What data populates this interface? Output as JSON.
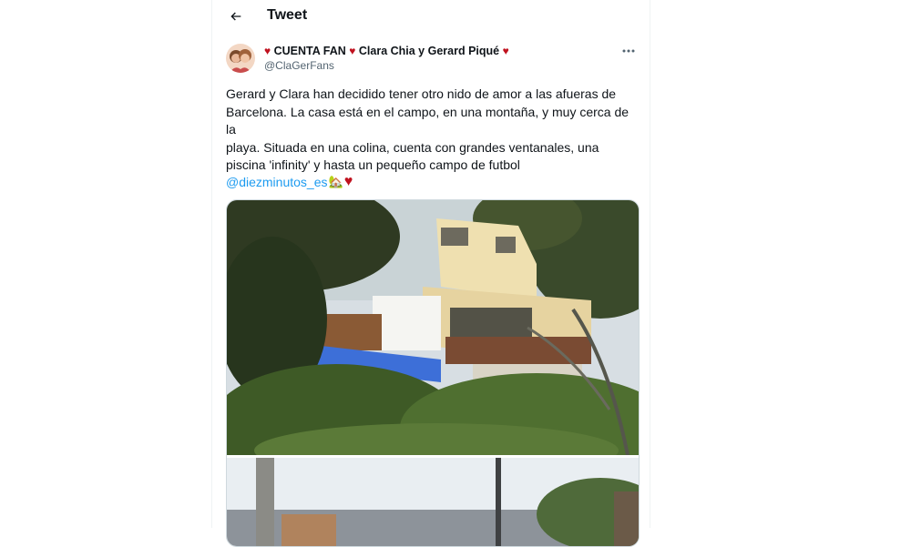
{
  "header": {
    "title": "Tweet",
    "back_icon": "arrow-left-icon"
  },
  "tweet": {
    "display_name_part1": "CUENTA FAN",
    "display_name_part2": "Clara Chia y Gerard Piqué",
    "handle": "@ClaGerFans",
    "text_lines": [
      "Gerard  y Clara han decidido tener otro nido de amor a las afueras de",
      "Barcelona. La casa está en el campo, en una montaña, y muy cerca de la",
      "playa. Situada en una colina, cuenta con grandes ventanales, una",
      "piscina 'infinity' y hasta un pequeño campo de futbol"
    ],
    "mention": "@diezminutos_es",
    "emoji_house": "🏡",
    "emoji_heart": "♥",
    "heart_color": "#c0121f",
    "link_color": "#1d9bf0",
    "more_icon": "more-horizontal-icon"
  }
}
